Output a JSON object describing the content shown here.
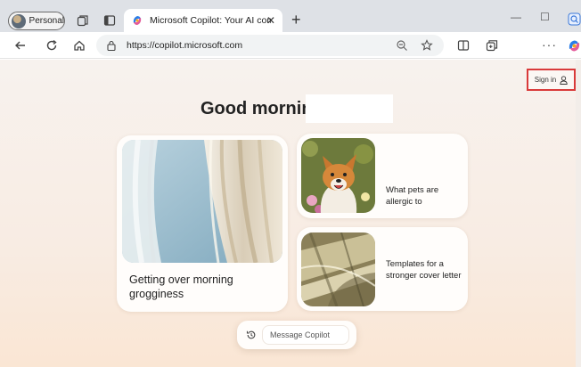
{
  "browser": {
    "profile_label": "Personal",
    "tab_title": "Microsoft Copilot: Your AI compa",
    "tab_close": "✕",
    "new_tab": "+",
    "url": "https://copilot.microsoft.com",
    "minimize": "—",
    "maximize": "☐",
    "more_menu": "···"
  },
  "page": {
    "sign_in_label": "Sign in",
    "greeting": "Good morning",
    "cards": [
      {
        "text": "Getting over morning grogginess"
      },
      {
        "text": "What pets are allergic to"
      },
      {
        "text": "Templates for a stronger cover letter"
      }
    ],
    "composer_placeholder": "Message Copilot"
  },
  "colors": {
    "accent_highlight": "#d93a3a",
    "page_bg_top": "#f7f2ee",
    "page_bg_bottom": "#fae6d4"
  },
  "icons": [
    "back-icon",
    "refresh-icon",
    "home-icon",
    "lock-icon",
    "zoom-icon",
    "favorite-star-icon",
    "split-screen-icon",
    "collections-icon",
    "copilot-icon",
    "tab-actions-icon",
    "vertical-tabs-icon",
    "user-icon",
    "history-icon"
  ]
}
